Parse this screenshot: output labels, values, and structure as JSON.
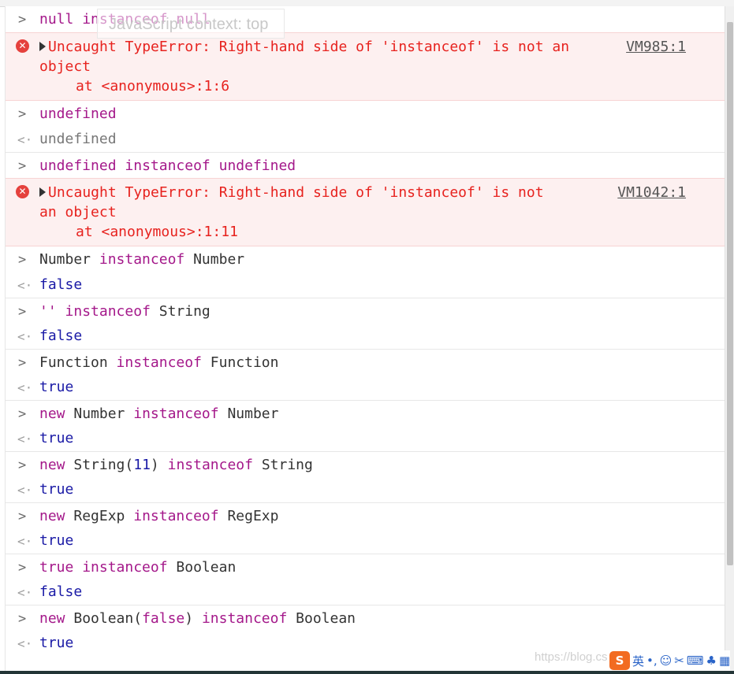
{
  "ghost_context": "JavaScript context: top",
  "errors": {
    "e1": {
      "line1": "Uncaught TypeError: Right-hand side of 'instanceof' is not an",
      "line2": "object",
      "at": "at <anonymous>:1:6",
      "src": "VM985:1"
    },
    "e2": {
      "line1": "Uncaught TypeError: Right-hand side of 'instanceof' is not",
      "line2": "an object",
      "at": "at <anonymous>:1:11",
      "src": "VM1042:1"
    }
  },
  "tokens": {
    "null": "null",
    "instanceof": "instanceof",
    "undefined": "undefined",
    "Number": "Number",
    "String": "String",
    "Function": "Function",
    "new": "new",
    "empty_str": "''",
    "num11": "11",
    "paren_open": "(",
    "paren_close": ")",
    "RegExp": "RegExp",
    "true": "true",
    "false": "false",
    "Boolean": "Boolean"
  },
  "outputs": {
    "undefined": "undefined",
    "false": "false",
    "true": "true"
  },
  "watermark": "https://blog.cs",
  "tray": {
    "logo": "S",
    "lang": "英",
    "items": [
      "•,",
      "☺",
      "✂",
      "⌨",
      "♣",
      "▦"
    ]
  },
  "glyphs": {
    "prompt": ">",
    "result": "<·",
    "error": "✕"
  }
}
